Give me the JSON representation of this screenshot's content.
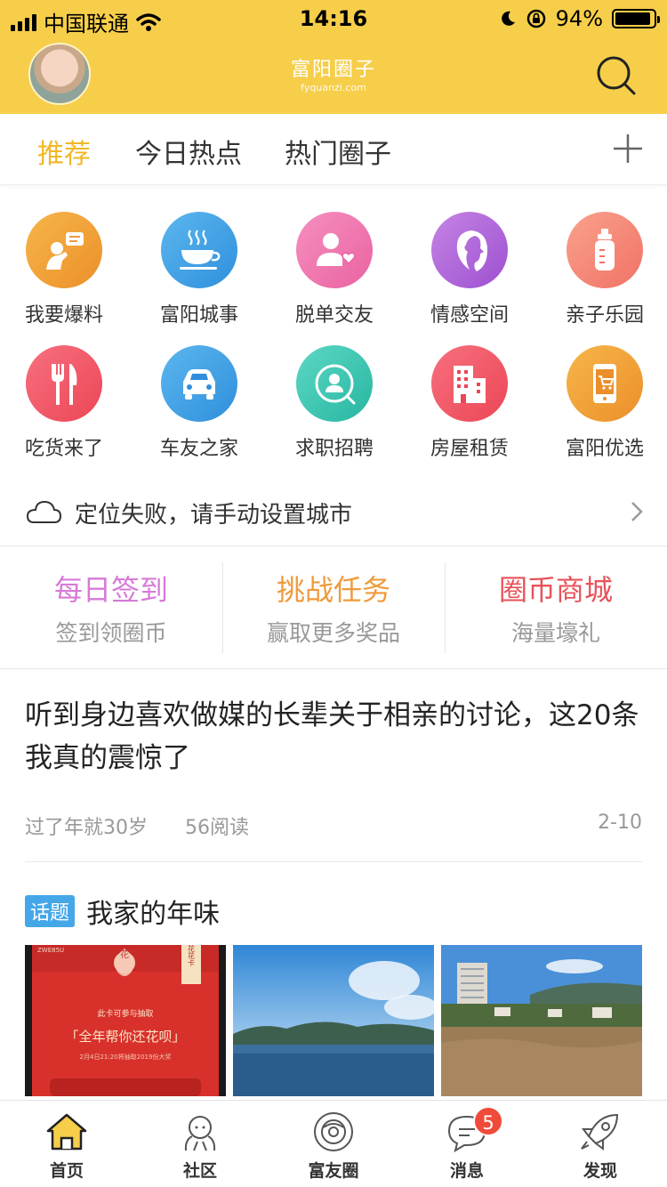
{
  "status_bar": {
    "carrier": "中国联通",
    "time": "14:16",
    "battery": "94%",
    "battery_level": 0.94
  },
  "header": {
    "logo_text": "富阳圈子",
    "logo_sub": "fyquanzi.com"
  },
  "tabs": [
    {
      "label": "推荐",
      "active": true
    },
    {
      "label": "今日热点",
      "active": false
    },
    {
      "label": "热门圈子",
      "active": false
    }
  ],
  "grid": [
    {
      "label": "我要爆料",
      "icon": "speaker-icon",
      "color": "#f0a338"
    },
    {
      "label": "富阳城事",
      "icon": "teacup-icon",
      "color": "#3fa3e6"
    },
    {
      "label": "脱单交友",
      "icon": "person-heart-icon",
      "color": "#f07ab0"
    },
    {
      "label": "情感空间",
      "icon": "face-profile-icon",
      "color": "#b46ddc"
    },
    {
      "label": "亲子乐园",
      "icon": "baby-bottle-icon",
      "color": "#f68a78"
    },
    {
      "label": "吃货来了",
      "icon": "fork-knife-icon",
      "color": "#f2586a"
    },
    {
      "label": "车友之家",
      "icon": "car-icon",
      "color": "#3fa3e6"
    },
    {
      "label": "求职招聘",
      "icon": "job-search-icon",
      "color": "#3cc8b4"
    },
    {
      "label": "房屋租赁",
      "icon": "building-icon",
      "color": "#f2586a"
    },
    {
      "label": "富阳优选",
      "icon": "shopping-phone-icon",
      "color": "#f0a338"
    }
  ],
  "location": {
    "text": "定位失败，请手动设置城市"
  },
  "actions": [
    {
      "title": "每日签到",
      "sub": "签到领圈币",
      "color": "#d67ad8"
    },
    {
      "title": "挑战任务",
      "sub": "赢取更多奖品",
      "color": "#ef9a3a"
    },
    {
      "title": "圈币商城",
      "sub": "海量壕礼",
      "color": "#e8525a"
    }
  ],
  "article": {
    "title": "听到身边喜欢做媒的长辈关于相亲的讨论，这20条我真的震惊了",
    "author": "过了年就30岁",
    "reads": "56阅读",
    "date": "2-10"
  },
  "topic": {
    "badge": "话题",
    "title": "我家的年味",
    "photo1": {
      "top": "ZWE85U",
      "flower": "花",
      "side": "花花卡",
      "line1": "此卡可参与抽取",
      "line2": "「全年帮你还花呗」",
      "line3": "2月4日21:20将抽取2019份大奖"
    }
  },
  "nav": [
    {
      "label": "首页",
      "icon": "home-icon"
    },
    {
      "label": "社区",
      "icon": "community-icon"
    },
    {
      "label": "富友圈",
      "icon": "friends-circle-icon"
    },
    {
      "label": "消息",
      "icon": "message-icon",
      "badge": "5"
    },
    {
      "label": "发现",
      "icon": "rocket-icon"
    }
  ]
}
